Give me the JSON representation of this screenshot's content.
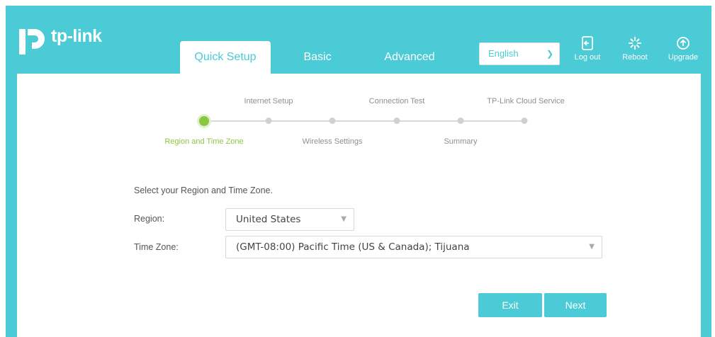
{
  "brand": {
    "name": "tp-link",
    "color": "#4acbd6",
    "accent_green": "#8cc63f"
  },
  "nav": {
    "tabs": [
      {
        "label": "Quick Setup",
        "active": true
      },
      {
        "label": "Basic",
        "active": false
      },
      {
        "label": "Advanced",
        "active": false
      }
    ]
  },
  "language": {
    "selected": "English"
  },
  "top_actions": [
    {
      "label": "Log out",
      "icon": "logout-icon"
    },
    {
      "label": "Reboot",
      "icon": "reboot-icon"
    },
    {
      "label": "Upgrade",
      "icon": "upgrade-icon"
    }
  ],
  "stepper": {
    "steps": [
      {
        "label": "Region and Time Zone",
        "active": true
      },
      {
        "label": "Internet Setup",
        "active": false
      },
      {
        "label": "Wireless Settings",
        "active": false
      },
      {
        "label": "Connection Test",
        "active": false
      },
      {
        "label": "Summary",
        "active": false
      },
      {
        "label": "TP-Link Cloud Service",
        "active": false
      }
    ]
  },
  "form": {
    "intro": "Select your Region and Time Zone.",
    "region": {
      "label": "Region:",
      "value": "United States"
    },
    "timezone": {
      "label": "Time Zone:",
      "value": "(GMT-08:00) Pacific Time (US & Canada); Tijuana"
    }
  },
  "buttons": {
    "exit": "Exit",
    "next": "Next"
  }
}
